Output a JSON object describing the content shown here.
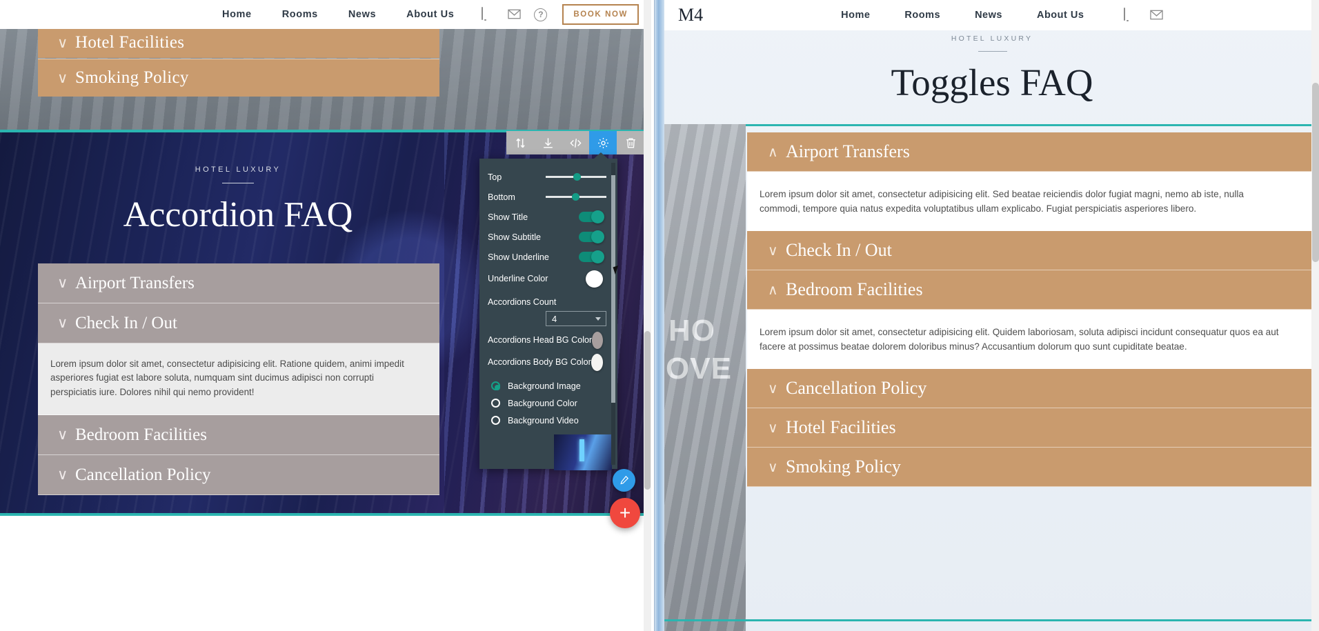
{
  "editor": {
    "topnav": {
      "links": [
        "Home",
        "Rooms",
        "News",
        "About Us"
      ],
      "icons": [
        "phone-icon",
        "mail-icon",
        "help-icon"
      ],
      "book_button": "BOOK NOW"
    },
    "top_section": {
      "accordions": [
        {
          "label": "Hotel Facilities",
          "chevron": "∨"
        },
        {
          "label": "Smoking Policy",
          "chevron": "∨"
        }
      ],
      "head_bg": "#c99b6e"
    },
    "selected_section": {
      "eyebrow": "HOTEL LUXURY",
      "title": "Accordion FAQ",
      "head_bg": "#a79e9e",
      "body_bg": "#ececec",
      "accordions": [
        {
          "label": "Airport Transfers",
          "chevron": "∨",
          "open": false
        },
        {
          "label": "Check In / Out",
          "chevron": "∨",
          "open": true,
          "body": "Lorem ipsum dolor sit amet, consectetur adipisicing elit. Ratione quidem, animi impedit asperiores fugiat est labore soluta, numquam sint ducimus adipisci non corrupti perspiciatis iure. Dolores nihil qui nemo provident!"
        },
        {
          "label": "Bedroom Facilities",
          "chevron": "∨",
          "open": false
        },
        {
          "label": "Cancellation Policy",
          "chevron": "∨",
          "open": false
        }
      ]
    },
    "toolbar": {
      "buttons": [
        "move-updown-icon",
        "download-icon",
        "code-icon",
        "gear-icon",
        "trash-icon"
      ],
      "active": "gear-icon"
    },
    "fab": {
      "brush": "brush-icon",
      "add": "+"
    }
  },
  "settings": {
    "rows": [
      {
        "label": "Top",
        "type": "slider",
        "value": 45
      },
      {
        "label": "Bottom",
        "type": "slider",
        "value": 45
      },
      {
        "label": "Show Title",
        "type": "toggle",
        "value": "on"
      },
      {
        "label": "Show Subtitle",
        "type": "toggle",
        "value": "on"
      },
      {
        "label": "Show Underline",
        "type": "toggle",
        "value": "on"
      },
      {
        "label": "Underline Color",
        "type": "color",
        "value": "#ffffff"
      }
    ],
    "count_label": "Accordions Count",
    "count_value": "4",
    "head_color_label": "Accordions Head BG Color",
    "head_color_value": "#a79e9e",
    "body_color_label": "Accordions Body BG Color",
    "body_color_value": "#f4f4f2",
    "background_options": [
      {
        "label": "Background Image",
        "selected": true
      },
      {
        "label": "Background Color",
        "selected": false
      },
      {
        "label": "Background Video",
        "selected": false
      }
    ]
  },
  "preview": {
    "logo": "M4",
    "links": [
      "Home",
      "Rooms",
      "News",
      "About Us"
    ],
    "eyebrow": "HOTEL LUXURY",
    "title": "Toggles FAQ",
    "photo_text_1": "HO",
    "photo_text_2": "OVE",
    "accordions": [
      {
        "label": "Airport Transfers",
        "chevron": "∧",
        "open": true,
        "body": "Lorem ipsum dolor sit amet, consectetur adipisicing elit. Sed beatae reiciendis dolor fugiat magni, nemo ab iste, nulla commodi, tempore quia natus expedita voluptatibus ullam explicabo. Fugiat perspiciatis asperiores libero."
      },
      {
        "label": "Check In / Out",
        "chevron": "∨",
        "open": false
      },
      {
        "label": "Bedroom Facilities",
        "chevron": "∧",
        "open": true,
        "body": "Lorem ipsum dolor sit amet, consectetur adipisicing elit. Quidem laboriosam, soluta adipisci incidunt consequatur quos ea aut facere at possimus beatae dolorem doloribus minus? Accusantium dolorum quo sunt cupiditate beatae."
      },
      {
        "label": "Cancellation Policy",
        "chevron": "∨",
        "open": false
      },
      {
        "label": "Hotel Facilities",
        "chevron": "∨",
        "open": false
      },
      {
        "label": "Smoking Policy",
        "chevron": "∨",
        "open": false
      }
    ],
    "head_bg": "#c99b6e"
  }
}
